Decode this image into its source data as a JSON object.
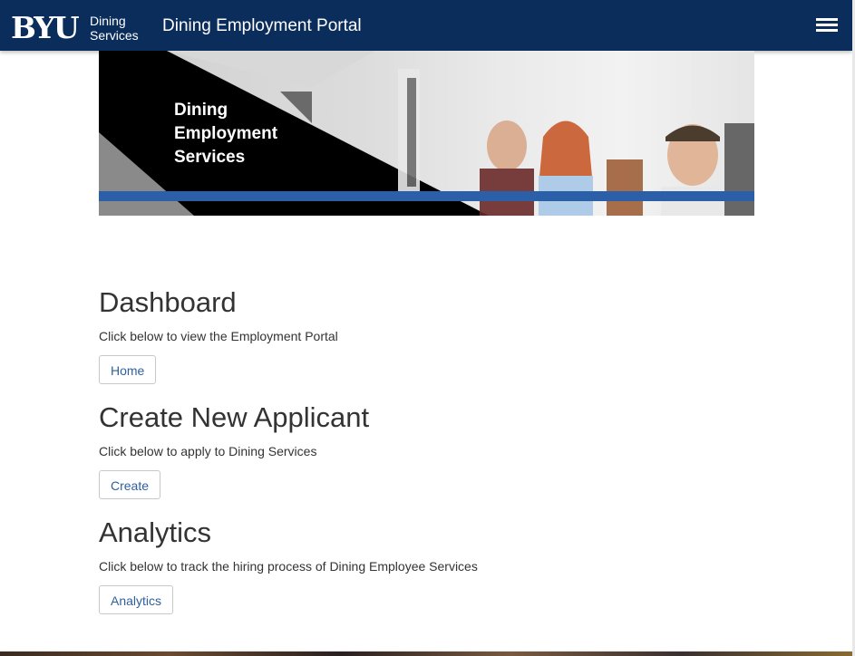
{
  "header": {
    "logo_text": "BYU",
    "sub_brand_line1": "Dining",
    "sub_brand_line2": "Services",
    "title": "Dining Employment Portal",
    "menu_icon": "hamburger-menu-icon",
    "background_color": "#0b2d5b"
  },
  "banner": {
    "line1": "Dining",
    "line2": "Employment",
    "line3": "Services",
    "stripe_color": "#2b5fa8"
  },
  "sections": [
    {
      "title": "Dashboard",
      "description": "Click below to view the Employment Portal",
      "button_label": "Home"
    },
    {
      "title": "Create New Applicant",
      "description": "Click below to apply to Dining Services",
      "button_label": "Create"
    },
    {
      "title": "Analytics",
      "description": "Click below to track the hiring process of Dining Employee Services",
      "button_label": "Analytics"
    }
  ],
  "colors": {
    "link_blue": "#2e5f9e",
    "text": "#333333"
  }
}
